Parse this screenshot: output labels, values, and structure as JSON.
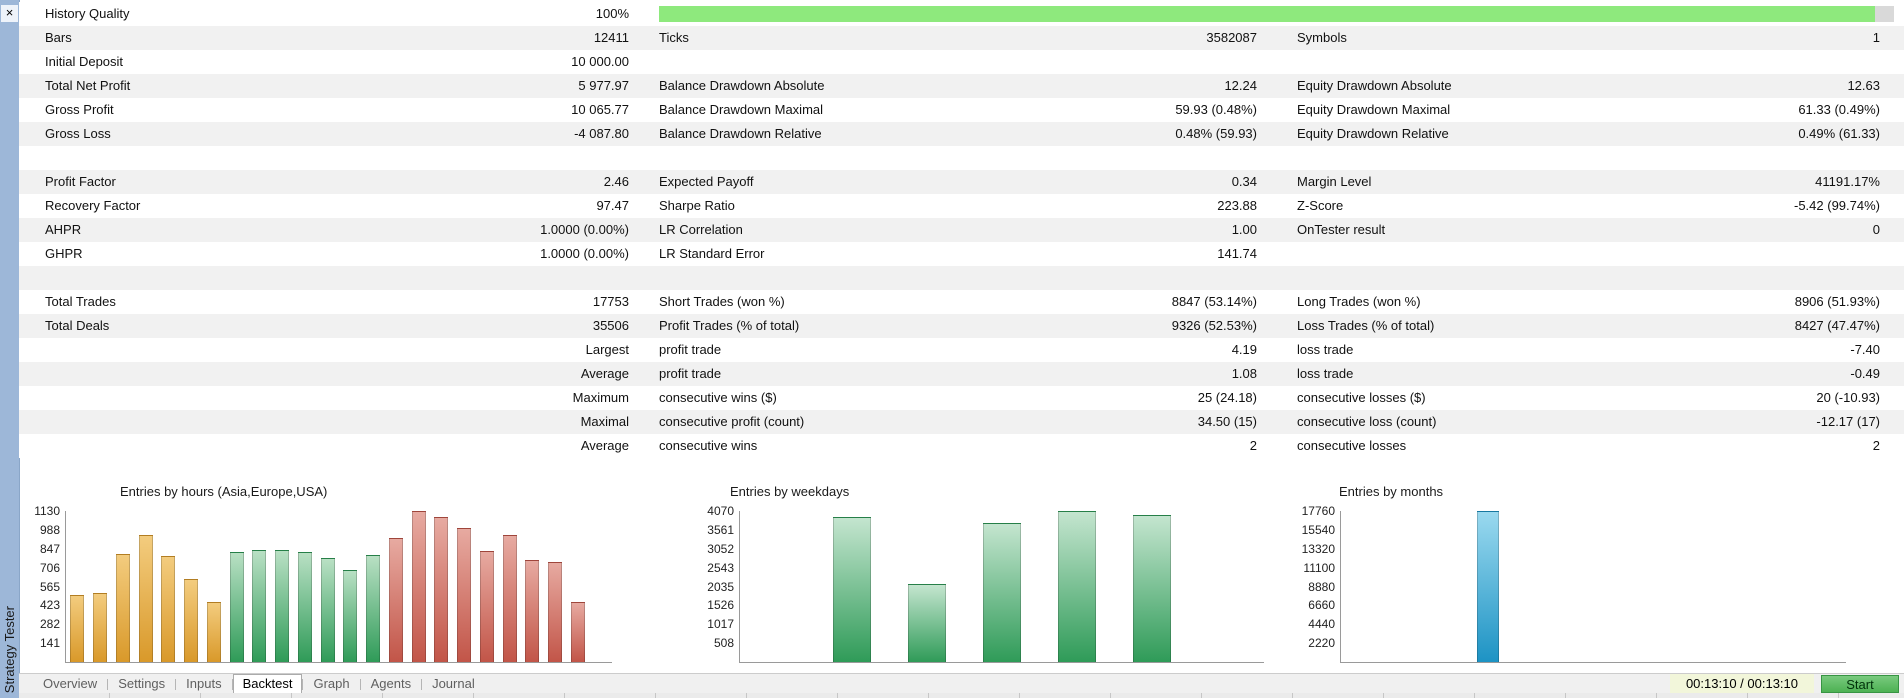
{
  "sidebar": {
    "title": "Strategy Tester",
    "close_icon": "×"
  },
  "report": {
    "history": {
      "label": "History Quality",
      "value": "100%",
      "fill_color": "#8ee97d",
      "fill_percent": 98.5
    },
    "rows": [
      {
        "c1l": "Bars",
        "c1v": "12411",
        "c2l": "Ticks",
        "c2v": "3582087",
        "c3l": "Symbols",
        "c3v": "1"
      },
      {
        "c1l": "Initial Deposit",
        "c1v": "10 000.00",
        "c2l": "",
        "c2v": "",
        "c3l": "",
        "c3v": ""
      },
      {
        "c1l": "Total Net Profit",
        "c1v": "5 977.97",
        "c2l": "Balance Drawdown Absolute",
        "c2v": "12.24",
        "c3l": "Equity Drawdown Absolute",
        "c3v": "12.63"
      },
      {
        "c1l": "Gross Profit",
        "c1v": "10 065.77",
        "c2l": "Balance Drawdown Maximal",
        "c2v": "59.93 (0.48%)",
        "c3l": "Equity Drawdown Maximal",
        "c3v": "61.33 (0.49%)"
      },
      {
        "c1l": "Gross Loss",
        "c1v": "-4 087.80",
        "c2l": "Balance Drawdown Relative",
        "c2v": "0.48% (59.93)",
        "c3l": "Equity Drawdown Relative",
        "c3v": "0.49% (61.33)"
      },
      {
        "spacer": true
      },
      {
        "c1l": "Profit Factor",
        "c1v": "2.46",
        "c2l": "Expected Payoff",
        "c2v": "0.34",
        "c3l": "Margin Level",
        "c3v": "41191.17%"
      },
      {
        "c1l": "Recovery Factor",
        "c1v": "97.47",
        "c2l": "Sharpe Ratio",
        "c2v": "223.88",
        "c3l": "Z-Score",
        "c3v": "-5.42 (99.74%)"
      },
      {
        "c1l": "AHPR",
        "c1v": "1.0000 (0.00%)",
        "c2l": "LR Correlation",
        "c2v": "1.00",
        "c3l": "OnTester result",
        "c3v": "0"
      },
      {
        "c1l": "GHPR",
        "c1v": "1.0000 (0.00%)",
        "c2l": "LR Standard Error",
        "c2v": "141.74",
        "c3l": "",
        "c3v": ""
      },
      {
        "spacer": true
      },
      {
        "c1l": "Total Trades",
        "c1v": "17753",
        "c2l": "Short Trades (won %)",
        "c2v": "8847 (53.14%)",
        "c3l": "Long Trades (won %)",
        "c3v": "8906 (51.93%)"
      },
      {
        "c1l": "Total Deals",
        "c1v": "35506",
        "c2l": "Profit Trades (% of total)",
        "c2v": "9326 (52.53%)",
        "c3l": "Loss Trades (% of total)",
        "c3v": "8427 (47.47%)"
      },
      {
        "c1l": "",
        "c1v": "Largest",
        "c2l": "profit trade",
        "c2v": "4.19",
        "c3l": "loss trade",
        "c3v": "-7.40"
      },
      {
        "c1l": "",
        "c1v": "Average",
        "c2l": "profit trade",
        "c2v": "1.08",
        "c3l": "loss trade",
        "c3v": "-0.49"
      },
      {
        "c1l": "",
        "c1v": "Maximum",
        "c2l": "consecutive wins ($)",
        "c2v": "25 (24.18)",
        "c3l": "consecutive losses ($)",
        "c3v": "20 (-10.93)"
      },
      {
        "c1l": "",
        "c1v": "Maximal",
        "c2l": "consecutive profit (count)",
        "c2v": "34.50 (15)",
        "c3l": "consecutive loss (count)",
        "c3v": "-12.17 (17)"
      },
      {
        "c1l": "",
        "c1v": "Average",
        "c2l": "consecutive wins",
        "c2v": "2",
        "c3l": "consecutive losses",
        "c3v": "2"
      }
    ]
  },
  "chart_data": [
    {
      "type": "bar",
      "title": "Entries by hours (Asia,Europe,USA)",
      "yticks": [
        1130,
        988,
        847,
        706,
        565,
        423,
        282,
        141
      ],
      "ylim": [
        0,
        1130
      ],
      "series": [
        {
          "name": "Asia",
          "values": [
            500,
            515,
            810,
            950,
            790,
            620,
            450
          ]
        },
        {
          "name": "Europe",
          "values": [
            820,
            840,
            840,
            825,
            780,
            690,
            800
          ]
        },
        {
          "name": "USA",
          "values": [
            930,
            1130,
            1085,
            1000,
            830,
            950,
            765,
            745,
            450,
            0
          ]
        }
      ],
      "colors": {
        "Asia": [
          "#f3cc7e",
          "#d9992a"
        ],
        "Europe": [
          "#b9e0c4",
          "#2f9b58"
        ],
        "USA": [
          "#e7aaa1",
          "#c25548"
        ]
      }
    },
    {
      "type": "bar",
      "title": "Entries by weekdays",
      "yticks": [
        4070,
        3561,
        3052,
        2543,
        2035,
        1526,
        1017,
        508
      ],
      "ylim": [
        0,
        4070
      ],
      "series": [
        {
          "name": "Weekdays",
          "values": [
            0,
            3900,
            2100,
            3750,
            4070,
            3950,
            0
          ]
        }
      ],
      "colors": {
        "Weekdays": [
          "#c4e5cf",
          "#2f9b58"
        ]
      }
    },
    {
      "type": "bar",
      "title": "Entries by months",
      "yticks": [
        17760,
        15540,
        13320,
        11100,
        8880,
        6660,
        4440,
        2220
      ],
      "ylim": [
        0,
        17760
      ],
      "series": [
        {
          "name": "Months",
          "values": [
            0,
            0,
            0,
            17760,
            0,
            0,
            0,
            0,
            0,
            0,
            0,
            0
          ]
        }
      ],
      "colors": {
        "Months": [
          "#9ad9ef",
          "#1d93c4"
        ]
      }
    }
  ],
  "tabs": {
    "items": [
      {
        "label": "Overview",
        "active": false
      },
      {
        "label": "Settings",
        "active": false
      },
      {
        "label": "Inputs",
        "active": false
      },
      {
        "label": "Backtest",
        "active": true
      },
      {
        "label": "Graph",
        "active": false
      },
      {
        "label": "Agents",
        "active": false
      },
      {
        "label": "Journal",
        "active": false
      }
    ],
    "timer": "00:13:10 / 00:13:10",
    "start_label": "Start",
    "start_color": "#4db153"
  }
}
